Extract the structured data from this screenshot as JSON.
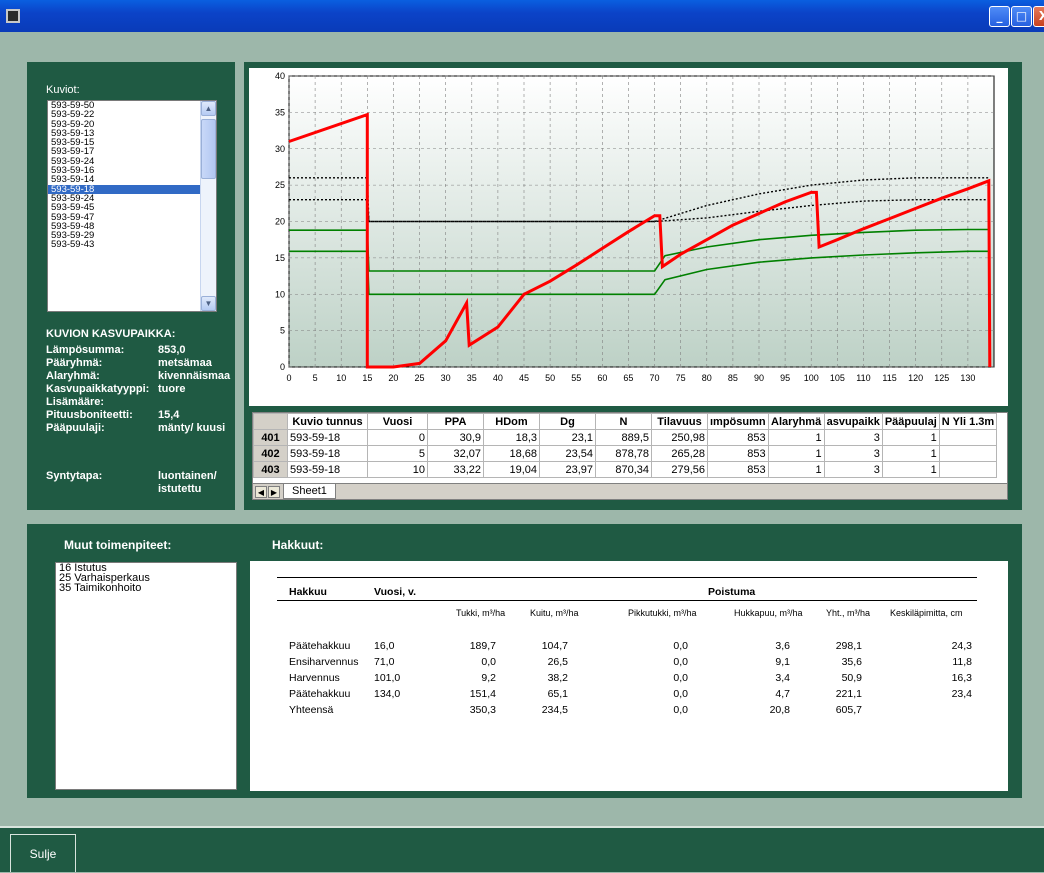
{
  "window": {
    "minimize": "_",
    "maximize": "□",
    "close": "X"
  },
  "kuviot": {
    "label": "Kuviot:",
    "items": [
      "593-59-50",
      "593-59-22",
      "593-59-20",
      "593-59-13",
      "593-59-15",
      "593-59-17",
      "593-59-24",
      "593-59-16",
      "593-59-14",
      "593-59-18",
      "593-59-24",
      "593-59-45",
      "593-59-47",
      "593-59-48",
      "593-59-29",
      "593-59-43"
    ],
    "selected_index": 9
  },
  "kasvupaikka": {
    "heading": "KUVION KASVUPAIKKA:",
    "rows": [
      {
        "label": "Lämpösumma:",
        "value": "853,0"
      },
      {
        "label": "Pääryhmä:",
        "value": "metsämaa"
      },
      {
        "label": "Alaryhmä:",
        "value": "kivennäismaa"
      },
      {
        "label": "Kasvupaikkatyyppi:",
        "value": "tuore"
      },
      {
        "label": "Lisämääre:",
        "value": ""
      },
      {
        "label": "Pituusboniteetti:",
        "value": "15,4"
      },
      {
        "label": "Pääpuulaji:",
        "value": "mänty/ kuusi"
      }
    ],
    "syntytapa_label": "Syntytapa:",
    "syntytapa_value1": "luontainen/",
    "syntytapa_value2": "istutettu"
  },
  "chart_data": {
    "type": "line",
    "xlim": [
      0,
      135
    ],
    "ylim": [
      0,
      40
    ],
    "xticks": [
      0,
      5,
      10,
      15,
      20,
      25,
      30,
      35,
      40,
      45,
      50,
      55,
      60,
      65,
      70,
      75,
      80,
      85,
      90,
      95,
      100,
      105,
      110,
      115,
      120,
      125,
      130
    ],
    "yticks": [
      0,
      5,
      10,
      15,
      20,
      25,
      30,
      35,
      40
    ],
    "grid": true,
    "series": [
      {
        "color": "#ff0000",
        "style": "solid",
        "x": [
          0,
          15,
          15,
          20,
          25,
          30,
          34,
          34.5,
          40,
          45,
          50,
          55,
          60,
          65,
          70,
          71,
          71.5,
          75,
          80,
          85,
          90,
          95,
          100,
          101,
          101.5,
          105,
          110,
          115,
          120,
          125,
          130,
          134,
          134.2
        ],
        "y": [
          31,
          34.7,
          0,
          0,
          0.5,
          3.6,
          8.8,
          3,
          5.5,
          10,
          11.8,
          14,
          16.3,
          18.6,
          20.8,
          20.8,
          13.8,
          15.5,
          17.5,
          19.5,
          21.1,
          22.7,
          24,
          24,
          16.5,
          17.5,
          19,
          20.4,
          21.8,
          23.2,
          24.5,
          25.6,
          0
        ]
      },
      {
        "color": "#008000",
        "style": "solid",
        "x": [
          0,
          15,
          15.3,
          70,
          72,
          80,
          90,
          100,
          110,
          120,
          130,
          134
        ],
        "y": [
          18.8,
          18.8,
          13.2,
          13.2,
          15.3,
          16.5,
          17.5,
          18.1,
          18.5,
          18.8,
          18.9,
          18.9
        ]
      },
      {
        "color": "#008000",
        "style": "solid",
        "x": [
          0,
          15,
          15.3,
          70,
          72,
          80,
          90,
          100,
          110,
          120,
          130,
          134
        ],
        "y": [
          15.9,
          15.9,
          10,
          10,
          12,
          13.4,
          14.4,
          15,
          15.4,
          15.7,
          15.9,
          15.9
        ]
      },
      {
        "color": "#000000",
        "style": "dotted",
        "x": [
          0,
          15,
          15.3,
          70,
          80,
          90,
          100,
          110,
          120,
          130,
          134
        ],
        "y": [
          26,
          26,
          20,
          20,
          22.2,
          23.8,
          25,
          25.7,
          26,
          26,
          26
        ]
      },
      {
        "color": "#000000",
        "style": "dotted",
        "x": [
          0,
          15,
          15.3,
          70,
          80,
          90,
          100,
          110,
          120,
          130,
          134
        ],
        "y": [
          23,
          23,
          20,
          20,
          20.5,
          21.4,
          22.2,
          22.8,
          23,
          23,
          23
        ]
      }
    ]
  },
  "sheet": {
    "headers": [
      "Kuvio tunnus",
      "Vuosi",
      "PPA",
      "HDom",
      "Dg",
      "N",
      "Tilavuus",
      "ımpösumn",
      "Alaryhmä",
      "asvupaikk",
      "Pääpuulaj",
      "N Yli 1.3m"
    ],
    "rows": [
      {
        "id": "401",
        "cells": [
          "593-59-18",
          "0",
          "30,9",
          "18,3",
          "23,1",
          "889,5",
          "250,98",
          "853",
          "1",
          "3",
          "1",
          ""
        ]
      },
      {
        "id": "402",
        "cells": [
          "593-59-18",
          "5",
          "32,07",
          "18,68",
          "23,54",
          "878,78",
          "265,28",
          "853",
          "1",
          "3",
          "1",
          ""
        ]
      },
      {
        "id": "403",
        "cells": [
          "593-59-18",
          "10",
          "33,22",
          "19,04",
          "23,97",
          "870,34",
          "279,56",
          "853",
          "1",
          "3",
          "1",
          ""
        ]
      }
    ],
    "tab": "Sheet1"
  },
  "muut": {
    "label": "Muut toimenpiteet:",
    "items": [
      "16 Istutus",
      "25 Varhaisperkaus",
      "35 Taimikonhoito"
    ]
  },
  "hakkuut": {
    "label": "Hakkuut:",
    "col_hakkuu": "Hakkuu",
    "col_vuosi": "Vuosi, v.",
    "poistuma": "Poistuma",
    "subheaders": [
      "Tukki, m³/ha",
      "Kuitu, m³/ha",
      "Pikkutukki, m³/ha",
      "Hukkapuu, m³/ha",
      "Yht., m³/ha",
      "Keskiläpimitta, cm"
    ],
    "rows": [
      {
        "name": "Päätehakkuu",
        "vuosi": "16,0",
        "vals": [
          "189,7",
          "104,7",
          "0,0",
          "3,6",
          "298,1",
          "24,3"
        ]
      },
      {
        "name": "Ensiharvennus",
        "vuosi": "71,0",
        "vals": [
          "0,0",
          "26,5",
          "0,0",
          "9,1",
          "35,6",
          "11,8"
        ]
      },
      {
        "name": "Harvennus",
        "vuosi": "101,0",
        "vals": [
          "9,2",
          "38,2",
          "0,0",
          "3,4",
          "50,9",
          "16,3"
        ]
      },
      {
        "name": "Päätehakkuu",
        "vuosi": "134,0",
        "vals": [
          "151,4",
          "65,1",
          "0,0",
          "4,7",
          "221,1",
          "23,4"
        ]
      },
      {
        "name": "Yhteensä",
        "vuosi": "",
        "vals": [
          "350,3",
          "234,5",
          "0,0",
          "20,8",
          "605,7",
          ""
        ]
      }
    ]
  },
  "footer": {
    "close_label": "Sulje"
  }
}
